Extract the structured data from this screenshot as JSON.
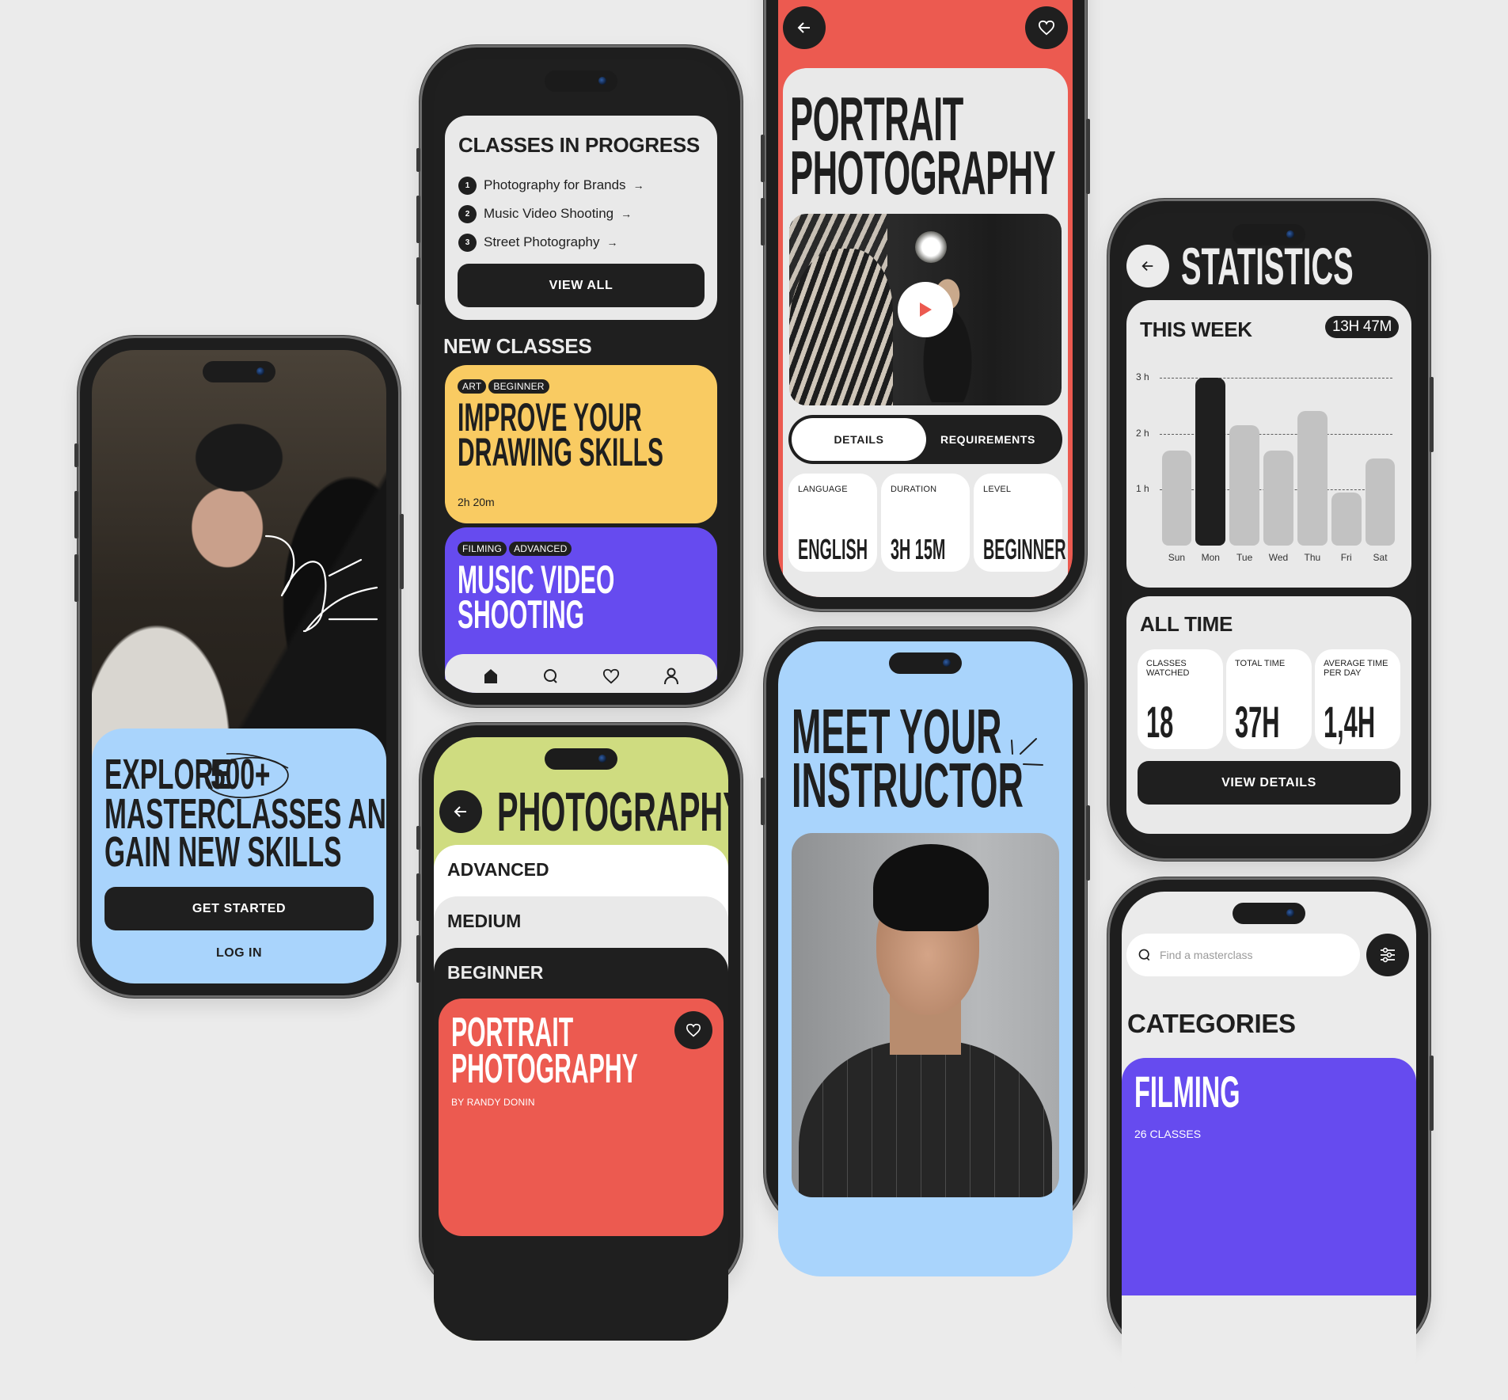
{
  "onboarding": {
    "headline_line1": "EXPLORE",
    "headline_highlight": "500+",
    "headline_line2": "MASTERCLASSES AND",
    "headline_line3": "GAIN NEW SKILLS",
    "get_started_label": "GET STARTED",
    "login_label": "LOG IN"
  },
  "home": {
    "in_progress_title": "CLASSES IN PROGRESS",
    "in_progress": [
      {
        "num": "1",
        "title": "Photography for Brands"
      },
      {
        "num": "2",
        "title": "Music Video Shooting"
      },
      {
        "num": "3",
        "title": "Street Photography"
      }
    ],
    "arrow_glyph": "→",
    "view_all_label": "VIEW ALL",
    "new_classes_title": "NEW CLASSES",
    "new_classes": [
      {
        "tags": [
          "ART",
          "BEGINNER"
        ],
        "title_line1": "IMPROVE YOUR",
        "title_line2": "DRAWING SKILLS",
        "duration": "2h 20m",
        "color": "#f9cb62"
      },
      {
        "tags": [
          "FILMING",
          "ADVANCED"
        ],
        "title_line1": "MUSIC VIDEO",
        "title_line2": "SHOOTING",
        "color": "#664bef"
      }
    ],
    "nav": [
      "home-icon",
      "search-icon",
      "heart-icon",
      "profile-icon"
    ]
  },
  "class_detail": {
    "title_line1": "PORTRAIT",
    "title_line2": "PHOTOGRAPHY",
    "tabs": [
      {
        "label": "DETAILS",
        "active": true
      },
      {
        "label": "REQUIREMENTS",
        "active": false
      }
    ],
    "info": [
      {
        "label": "LANGUAGE",
        "value": "ENGLISH"
      },
      {
        "label": "DURATION",
        "value": "3H 15M"
      },
      {
        "label": "LEVEL",
        "value": "BEGINNER"
      }
    ],
    "accent": "#ec5a50"
  },
  "statistics": {
    "title": "STATISTICS",
    "this_week_title": "THIS WEEK",
    "this_week_total": "13H 47M",
    "all_time_title": "ALL TIME",
    "all_time": [
      {
        "label_line1": "CLASSES",
        "label_line2": "WATCHED",
        "value": "18"
      },
      {
        "label_line1": "TOTAL TIME",
        "label_line2": "",
        "value": "37H"
      },
      {
        "label_line1": "AVERAGE TIME",
        "label_line2": "PER DAY",
        "value": "1,4H"
      }
    ],
    "view_details_label": "VIEW DETAILS"
  },
  "chart_data": {
    "type": "bar",
    "title": "THIS WEEK",
    "categories": [
      "Sun",
      "Mon",
      "Tue",
      "Wed",
      "Thu",
      "Fri",
      "Sat"
    ],
    "values": [
      1.7,
      3.0,
      2.15,
      1.7,
      2.4,
      0.95,
      1.55
    ],
    "highlighted": "Mon",
    "yticks": [
      "1 h",
      "2 h",
      "3 h"
    ],
    "ylim": [
      0,
      3
    ],
    "unit": "hours",
    "grid": true,
    "xlabel": "",
    "ylabel": ""
  },
  "category_page": {
    "title": "PHOTOGRAPHY",
    "levels": [
      "ADVANCED",
      "MEDIUM",
      "BEGINNER"
    ],
    "featured": {
      "title_line1": "PORTRAIT",
      "title_line2": "PHOTOGRAPHY",
      "author": "BY RANDY DONIN"
    },
    "bg_color": "#cfdc80"
  },
  "instructor": {
    "title_line1": "MEET YOUR",
    "title_line2": "INSTRUCTOR"
  },
  "search_page": {
    "search_placeholder": "Find a masterclass",
    "categories_title": "CATEGORIES",
    "categories": [
      {
        "name": "FILMING",
        "count": "26 CLASSES",
        "color": "#664bef"
      }
    ]
  }
}
